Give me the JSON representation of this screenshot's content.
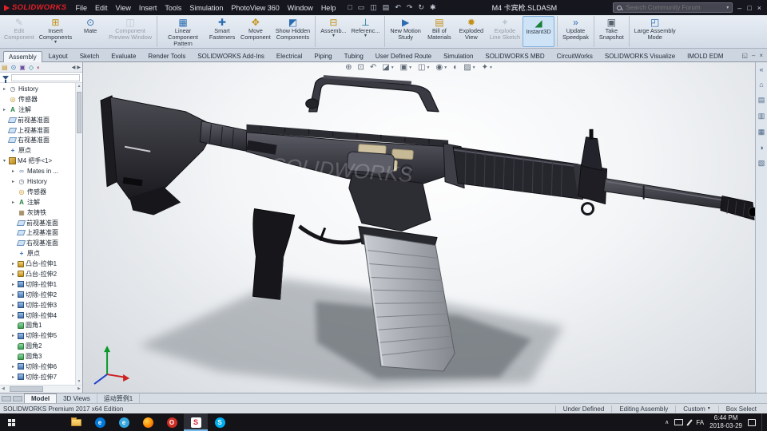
{
  "colors": {
    "sw_red": "#e12026",
    "titlebar_bg": "#16161f",
    "taskbar_bg": "#131318",
    "ribbon_bg_top": "#e9eef5",
    "ribbon_bg_bottom": "#d2dbe6",
    "accent_blue": "#2b6cb0",
    "viewport_center": "#ffffff",
    "viewport_edge": "#d4d8dd"
  },
  "title_bar": {
    "logo_text": "SOLIDWORKS",
    "menus": [
      {
        "name": "menu-file",
        "label": "File"
      },
      {
        "name": "menu-edit",
        "label": "Edit"
      },
      {
        "name": "menu-view",
        "label": "View"
      },
      {
        "name": "menu-insert",
        "label": "Insert"
      },
      {
        "name": "menu-tools",
        "label": "Tools"
      },
      {
        "name": "menu-simulation",
        "label": "Simulation"
      },
      {
        "name": "menu-photoview-360",
        "label": "PhotoView 360"
      },
      {
        "name": "menu-window",
        "label": "Window"
      },
      {
        "name": "menu-help",
        "label": "Help"
      }
    ],
    "quick_tools": [
      {
        "name": "new-document-icon",
        "glyph": "□"
      },
      {
        "name": "open-document-icon",
        "glyph": "▭"
      },
      {
        "name": "save-icon",
        "glyph": "◫"
      },
      {
        "name": "print-icon",
        "glyph": "▤"
      },
      {
        "name": "undo-icon",
        "glyph": "↶"
      },
      {
        "name": "redo-icon",
        "glyph": "↷"
      },
      {
        "name": "rebuild-icon",
        "glyph": "↻"
      },
      {
        "name": "options-icon",
        "glyph": "✱"
      }
    ],
    "document_title": "M4 卡宾枪.SLDASM",
    "search": {
      "placeholder": "Search Community Forum"
    },
    "window_controls": [
      {
        "name": "minimize-button",
        "glyph": "–"
      },
      {
        "name": "maximize-button",
        "glyph": "□"
      },
      {
        "name": "close-button",
        "glyph": "×"
      }
    ]
  },
  "ribbon": {
    "buttons": [
      {
        "name": "edit-component-button",
        "label": "Edit\nComponent",
        "glyph": "✎",
        "icon_color": "#7d8a99",
        "disabled": true
      },
      {
        "name": "insert-components-button",
        "label": "Insert\nComponents",
        "glyph": "⊞",
        "icon_color": "#c29016",
        "dd": true
      },
      {
        "name": "mate-button",
        "label": "Mate",
        "glyph": "⊙",
        "icon_color": "#2b6cb0"
      },
      {
        "name": "component-preview-window-button",
        "label": "Component\nPreview Window",
        "glyph": "◫",
        "icon_color": "#8b97a5",
        "disabled": true
      },
      {
        "name": "linear-component-pattern-button",
        "label": "Linear\nComponent Pattern",
        "glyph": "▦",
        "icon_color": "#2b6cb0",
        "dd": true,
        "sep": true
      },
      {
        "name": "smart-fasteners-button",
        "label": "Smart\nFasteners",
        "glyph": "✚",
        "icon_color": "#2b6cb0"
      },
      {
        "name": "move-component-button",
        "label": "Move\nComponent",
        "glyph": "✥",
        "icon_color": "#c29016"
      },
      {
        "name": "show-hidden-components-button",
        "label": "Show Hidden\nComponents",
        "glyph": "◩",
        "icon_color": "#2b6cb0"
      },
      {
        "name": "assembly-features-button",
        "label": "Assemb...",
        "glyph": "⊟",
        "icon_color": "#c29016",
        "dd": true,
        "sep": true
      },
      {
        "name": "reference-geometry-button",
        "label": "Referenc...",
        "glyph": "⊥",
        "icon_color": "#0e7490",
        "dd": true
      },
      {
        "name": "new-motion-study-button",
        "label": "New Motion\nStudy",
        "glyph": "▶",
        "icon_color": "#2b6cb0",
        "sep": true
      },
      {
        "name": "bill-of-materials-button",
        "label": "Bill of\nMaterials",
        "glyph": "▤",
        "icon_color": "#c29016"
      },
      {
        "name": "exploded-view-button",
        "label": "Exploded\nView",
        "glyph": "✹",
        "icon_color": "#c29016"
      },
      {
        "name": "explode-line-sketch-button",
        "label": "Explode\nLine Sketch",
        "glyph": "✦",
        "icon_color": "#8b97a5",
        "disabled": true
      },
      {
        "name": "instant3d-button",
        "label": "Instant3D",
        "glyph": "◢",
        "icon_color": "#1a7f37",
        "active": true
      },
      {
        "name": "update-speedpak-button",
        "label": "Update\nSpeedpak",
        "glyph": "»",
        "icon_color": "#2b6cb0",
        "sep": true
      },
      {
        "name": "take-snapshot-button",
        "label": "Take\nSnapshot",
        "glyph": "▣",
        "icon_color": "#55606c",
        "sep": true
      },
      {
        "name": "large-assembly-mode-button",
        "label": "Large Assembly\nMode",
        "glyph": "◰",
        "icon_color": "#2b6cb0",
        "sep": true
      }
    ]
  },
  "command_tabs": [
    {
      "name": "tab-assembly",
      "label": "Assembly",
      "active": true
    },
    {
      "name": "tab-layout",
      "label": "Layout"
    },
    {
      "name": "tab-sketch",
      "label": "Sketch"
    },
    {
      "name": "tab-evaluate",
      "label": "Evaluate"
    },
    {
      "name": "tab-render-tools",
      "label": "Render Tools"
    },
    {
      "name": "tab-solidworks-add-ins",
      "label": "SOLIDWORKS Add-Ins"
    },
    {
      "name": "tab-electrical",
      "label": "Electrical"
    },
    {
      "name": "tab-piping",
      "label": "Piping"
    },
    {
      "name": "tab-tubing",
      "label": "Tubing"
    },
    {
      "name": "tab-user-defined-route",
      "label": "User Defined Route"
    },
    {
      "name": "tab-simulation",
      "label": "Simulation"
    },
    {
      "name": "tab-solidworks-mbd",
      "label": "SOLIDWORKS MBD"
    },
    {
      "name": "tab-circuitworks",
      "label": "CircuitWorks"
    },
    {
      "name": "tab-solidworks-visualize",
      "label": "SOLIDWORKS Visualize"
    },
    {
      "name": "tab-imold-edm",
      "label": "IMOLD EDM"
    }
  ],
  "doc_window_controls": [
    {
      "name": "doc-restore-button",
      "glyph": "◱"
    },
    {
      "name": "doc-minimize-button",
      "glyph": "–"
    },
    {
      "name": "doc-close-button",
      "glyph": "×"
    }
  ],
  "feature_manager": {
    "tabs": [
      {
        "name": "featuremanager-tab-icon",
        "glyph": "▤",
        "color": "#c29016"
      },
      {
        "name": "propertymanager-tab-icon",
        "glyph": "⊙",
        "color": "#2b6cb0"
      },
      {
        "name": "configurationmanager-tab-icon",
        "glyph": "▣",
        "color": "#6a4fa0"
      },
      {
        "name": "dimxpertmanager-tab-icon",
        "glyph": "◇",
        "color": "#0e7490"
      },
      {
        "name": "displaymanager-tab-icon",
        "glyph": "◐",
        "color": "#b0506a"
      }
    ],
    "tree": [
      {
        "label": "History",
        "icon": "history-icon",
        "exp": "▸"
      },
      {
        "label": "传感器",
        "icon": "sensor-icon",
        "exp": ""
      },
      {
        "label": "注解",
        "icon": "annotations-icon",
        "exp": "▸"
      },
      {
        "label": "前视基准面",
        "icon": "plane-icon",
        "exp": ""
      },
      {
        "label": "上视基准面",
        "icon": "plane-icon",
        "exp": ""
      },
      {
        "label": "右视基准面",
        "icon": "plane-icon",
        "exp": ""
      },
      {
        "label": "原点",
        "icon": "origin-icon",
        "exp": ""
      },
      {
        "label": "M4 把手<1>",
        "icon": "component-icon",
        "exp": "▾"
      },
      {
        "label": "Mates in ...",
        "icon": "mates-icon",
        "exp": "▸",
        "nested": true
      },
      {
        "label": "History",
        "icon": "history-icon",
        "exp": "▸",
        "nested": true
      },
      {
        "label": "传感器",
        "icon": "sensor-icon",
        "exp": "",
        "nested": true
      },
      {
        "label": "注解",
        "icon": "annotations-icon",
        "exp": "▸",
        "nested": true
      },
      {
        "label": "灰铸铁",
        "icon": "material-icon",
        "exp": "",
        "nested": true
      },
      {
        "label": "前视基准面",
        "icon": "plane-icon",
        "exp": "",
        "nested": true
      },
      {
        "label": "上视基准面",
        "icon": "plane-icon",
        "exp": "",
        "nested": true
      },
      {
        "label": "右视基准面",
        "icon": "plane-icon",
        "exp": "",
        "nested": true
      },
      {
        "label": "原点",
        "icon": "origin-icon",
        "exp": "",
        "nested": true
      },
      {
        "label": "凸台-拉伸1",
        "icon": "boss-icon",
        "exp": "▸",
        "nested": true
      },
      {
        "label": "凸台-拉伸2",
        "icon": "boss-icon",
        "exp": "▸",
        "nested": true
      },
      {
        "label": "切除-拉伸1",
        "icon": "cut-icon",
        "exp": "▸",
        "nested": true
      },
      {
        "label": "切除-拉伸2",
        "icon": "cut-icon",
        "exp": "▸",
        "nested": true
      },
      {
        "label": "切除-拉伸3",
        "icon": "cut-icon",
        "exp": "▸",
        "nested": true
      },
      {
        "label": "切除-拉伸4",
        "icon": "cut-icon",
        "exp": "▸",
        "nested": true
      },
      {
        "label": "圆角1",
        "icon": "fillet-icon",
        "exp": "",
        "nested": true
      },
      {
        "label": "切除-拉伸5",
        "icon": "cut-icon",
        "exp": "▸",
        "nested": true
      },
      {
        "label": "圆角2",
        "icon": "fillet-icon",
        "exp": "",
        "nested": true
      },
      {
        "label": "圆角3",
        "icon": "fillet-icon",
        "exp": "",
        "nested": true
      },
      {
        "label": "切除-拉伸6",
        "icon": "cut-icon",
        "exp": "▸",
        "nested": true
      },
      {
        "label": "切除-拉伸7",
        "icon": "cut-icon",
        "exp": "▸",
        "nested": true
      }
    ]
  },
  "viewport": {
    "hud": [
      {
        "name": "zoom-to-fit-icon",
        "glyph": "⊕"
      },
      {
        "name": "zoom-to-area-icon",
        "glyph": "⊡"
      },
      {
        "name": "previous-view-icon",
        "glyph": "↶"
      },
      {
        "name": "section-view-icon",
        "glyph": "◪",
        "dd": true
      },
      {
        "name": "view-orientation-icon",
        "glyph": "▣",
        "dd": true
      },
      {
        "name": "display-style-icon",
        "glyph": "◫",
        "dd": true
      },
      {
        "name": "hide-show-items-icon",
        "glyph": "◉",
        "dd": true
      },
      {
        "name": "edit-appearance-icon",
        "glyph": "◐"
      },
      {
        "name": "apply-scene-icon",
        "glyph": "▨",
        "dd": true
      },
      {
        "name": "view-settings-icon",
        "glyph": "✦",
        "dd": true
      }
    ],
    "watermark": "SOLIDWORKS"
  },
  "task_pane": [
    {
      "name": "collapse-taskpane-icon",
      "glyph": "«"
    },
    {
      "name": "solidworks-resources-icon",
      "glyph": "⌂"
    },
    {
      "name": "design-library-icon",
      "glyph": "▤"
    },
    {
      "name": "file-explorer-icon",
      "glyph": "▥"
    },
    {
      "name": "view-palette-icon",
      "glyph": "▦"
    },
    {
      "name": "appearances-scenes-icon",
      "glyph": "◑"
    },
    {
      "name": "custom-properties-icon",
      "glyph": "▧"
    }
  ],
  "bottom_tabs": [
    {
      "name": "model-tab",
      "label": "Model",
      "active": true
    },
    {
      "name": "3d-views-tab",
      "label": "3D Views"
    },
    {
      "name": "motion-study-tab",
      "label": "运动算例1"
    }
  ],
  "status_bar": {
    "edition": "SOLIDWORKS Premium 2017 x64 Edition",
    "items": [
      {
        "name": "definition-status",
        "label": "Under Defined"
      },
      {
        "name": "editing-mode-status",
        "label": "Editing Assembly"
      },
      {
        "name": "units-dropdown",
        "label": "Custom",
        "dd": true
      },
      {
        "name": "selection-mode-status",
        "label": "Box Select"
      }
    ]
  },
  "taskbar": {
    "icons": [
      {
        "name": "taskbar-file-explorer-icon",
        "glyph": ""
      },
      {
        "name": "taskbar-edge-icon",
        "glyph": "e"
      },
      {
        "name": "taskbar-ie-icon",
        "glyph": "e"
      },
      {
        "name": "taskbar-firefox-icon",
        "glyph": ""
      },
      {
        "name": "taskbar-opera-icon",
        "glyph": "O"
      },
      {
        "name": "taskbar-solidworks-icon",
        "glyph": "S",
        "active": true
      },
      {
        "name": "taskbar-skype-icon",
        "glyph": "S"
      }
    ],
    "tray": {
      "language": "FA",
      "time": "6:44 PM",
      "date": "2018-03-29"
    }
  }
}
